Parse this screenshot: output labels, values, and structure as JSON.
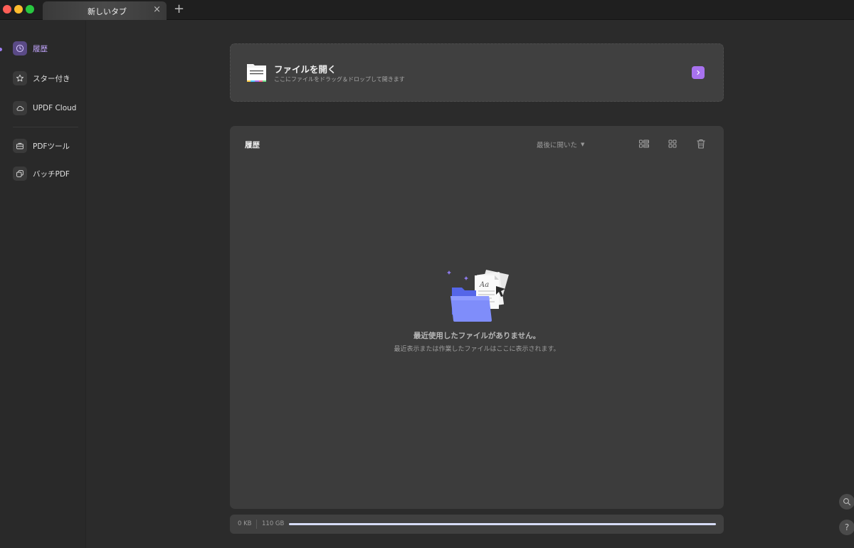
{
  "window": {
    "tab_label": "新しいタブ",
    "tab_close": "×",
    "new_tab": "+"
  },
  "sidebar": {
    "items": [
      {
        "label": "履歴",
        "icon": "clock-icon",
        "active": true
      },
      {
        "label": "スター付き",
        "icon": "star-icon"
      },
      {
        "label": "UPDF Cloud",
        "icon": "cloud-icon"
      },
      {
        "label": "PDFツール",
        "icon": "toolbox-icon"
      },
      {
        "label": "バッチPDF",
        "icon": "batch-icon"
      }
    ]
  },
  "open_file": {
    "title": "ファイルを開く",
    "subtitle": "ここにファイルをドラッグ＆ドロップして開きます",
    "arrow": "›"
  },
  "history": {
    "title": "履歴",
    "sort_label": "最後に開いた",
    "sort_caret": "▼",
    "empty_title": "最近使用したファイルがありません。",
    "empty_subtitle": "最近表示または作業したファイルはここに表示されます。"
  },
  "storage": {
    "used": "0 KB",
    "total": "110 GB",
    "fill_fraction": 1.0
  },
  "floating": {
    "search": "⌕",
    "help": "?"
  },
  "colors": {
    "accent": "#a872ef",
    "active_text": "#c3a6ff",
    "folder_blue": "#6b7cf2"
  }
}
